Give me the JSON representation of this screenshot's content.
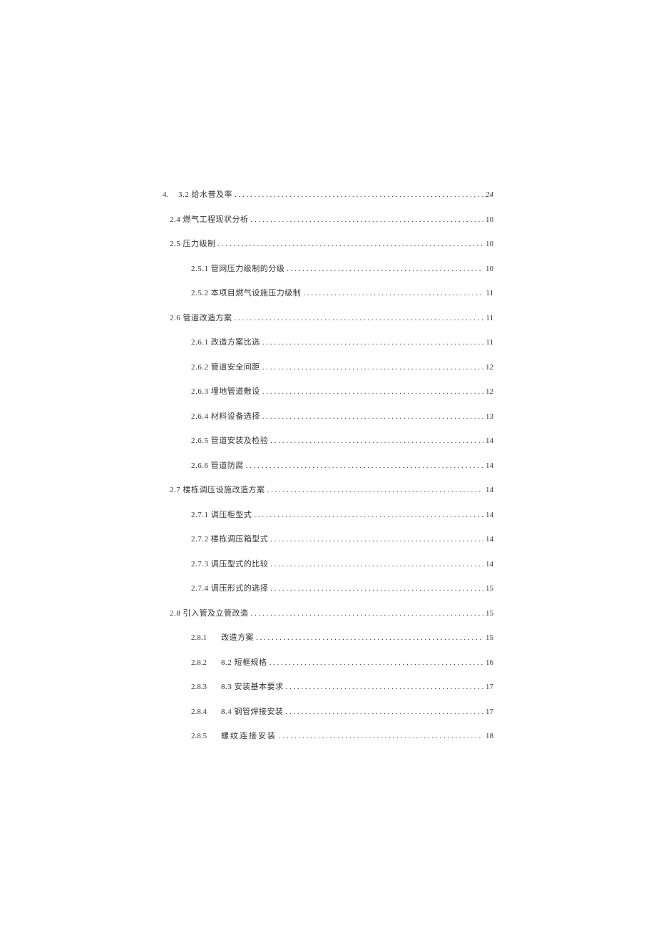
{
  "toc": [
    {
      "prefix": "4.",
      "label": "3.2 给水普及率",
      "page": "24",
      "level": "top",
      "italicPage": true
    },
    {
      "label": "2.4 燃气工程现状分析",
      "page": "10",
      "level": "level1"
    },
    {
      "label": "2.5 压力级制",
      "page": "10",
      "level": "level1"
    },
    {
      "label": "2.5.1 管网压力级制的分级",
      "page": "10",
      "level": "level2"
    },
    {
      "label": "2.5.2 本项目燃气设施压力级制",
      "page": "11",
      "level": "level2"
    },
    {
      "label": "2.6 管道改造方案",
      "page": "11",
      "level": "level1"
    },
    {
      "label": "2.6.1 改造方案比选",
      "page": "11",
      "level": "level2"
    },
    {
      "label": "2.6.2 管道安全间距",
      "page": "12",
      "level": "level2"
    },
    {
      "label": "2.6.3 埋地管道敷设",
      "page": "12",
      "level": "level2"
    },
    {
      "label": "2.6.4 材料设备选择",
      "page": "13",
      "level": "level2"
    },
    {
      "label": "2.6.5 管道安装及检验",
      "page": "14",
      "level": "level2"
    },
    {
      "label": "2.6.6 管道防腐",
      "page": "14",
      "level": "level2"
    },
    {
      "label": "2.7 楼栋调压设施改造方案",
      "page": "14",
      "level": "level1"
    },
    {
      "label": "2.7.1 调压柜型式",
      "page": "14",
      "level": "level2"
    },
    {
      "label": "2.7.2 楼栋调压箱型式",
      "page": "14",
      "level": "level2"
    },
    {
      "label": "2.7.3 调压型式的比较",
      "page": "14",
      "level": "level2"
    },
    {
      "label": "2.7.4 调压形式的选择",
      "page": "15",
      "level": "level2"
    },
    {
      "label": "2.8 引入管及立管改造",
      "page": "15",
      "level": "level1"
    },
    {
      "num": "2.8.1",
      "label": "改造方案",
      "page": "15",
      "level": "level2-numbered"
    },
    {
      "num": "2.8.2",
      "label": "8.2 短框规格",
      "page": "16",
      "level": "level2-numbered"
    },
    {
      "num": "2.8.3",
      "label": "8.3 安装基本要求",
      "page": "17",
      "level": "level2-numbered"
    },
    {
      "num": "2.8.4",
      "label": "8.4 钢管焊接安装",
      "page": "17",
      "level": "level2-numbered"
    },
    {
      "num": "2.8.5",
      "label": "螺纹连接安装",
      "page": "18",
      "level": "level2-numbered",
      "spacedLabel": true
    }
  ]
}
